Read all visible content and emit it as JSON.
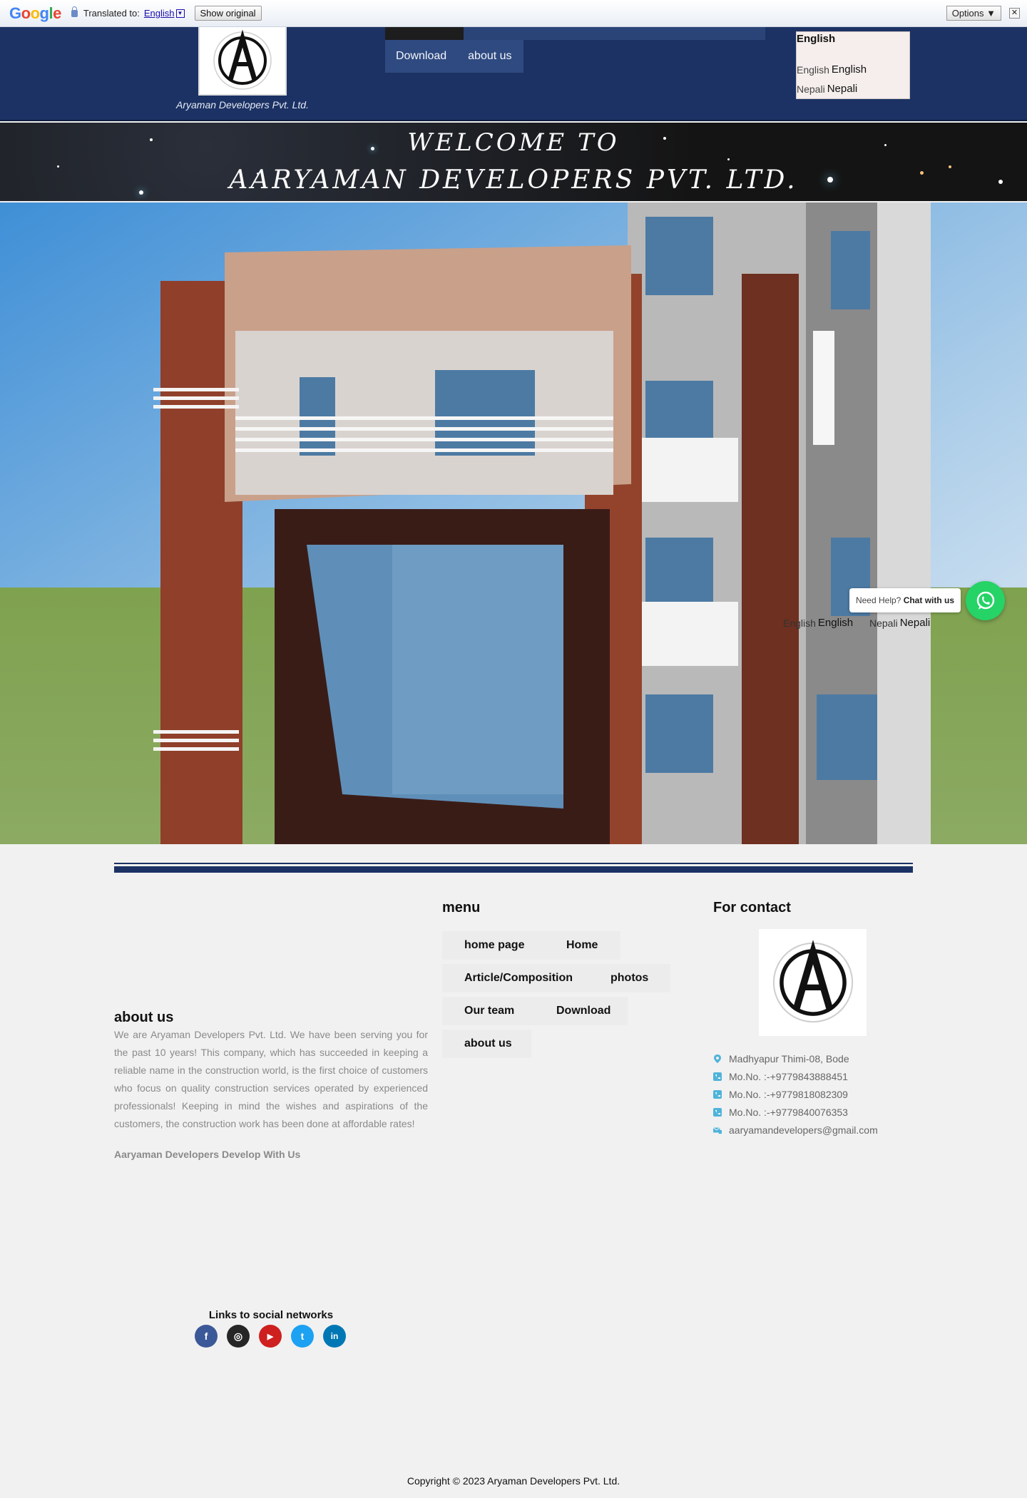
{
  "translate_bar": {
    "logo": "Google",
    "label": "Translated to:",
    "language": "English",
    "show_original": "Show original",
    "options": "Options ▼",
    "close": "✕"
  },
  "header": {
    "company_caption": "Aryaman Developers Pvt. Ltd.",
    "nav": [
      {
        "label": "Download"
      },
      {
        "label": "about us"
      }
    ],
    "language_switcher": {
      "current": "English",
      "options": [
        {
          "alt": "English",
          "label": "English"
        },
        {
          "alt": "Nepali",
          "label": "Nepali"
        }
      ]
    }
  },
  "banner": {
    "line1": "WELCOME TO",
    "line2": "AARYAMAN DEVELOPERS PVT. LTD."
  },
  "hero": {
    "chat_tip_prefix": "Need Help?",
    "chat_tip_strong": "Chat with us",
    "languages": [
      {
        "alt": "English",
        "label": "English"
      },
      {
        "alt": "Nepali",
        "label": "Nepali"
      }
    ]
  },
  "about": {
    "title": "about us",
    "text": "We are Aryaman Developers Pvt. Ltd. We have been serving you for the past 10 years! This company, which has succeeded in keeping a reliable name in the construction world, is the first choice of customers who focus on quality construction services operated by experienced professionals! Keeping in mind the wishes and aspirations of the customers, the construction work has been done at affordable rates!",
    "tagline": "Aaryaman Developers Develop With Us"
  },
  "menu": {
    "title": "menu",
    "items": [
      {
        "label": "home page"
      },
      {
        "label": "Home"
      },
      {
        "label": "Article/Composition"
      },
      {
        "label": "photos"
      },
      {
        "label": "Our team"
      },
      {
        "label": "Download"
      },
      {
        "label": "about us"
      }
    ]
  },
  "contact": {
    "title": "For contact",
    "address": "Madhyapur Thimi-08, Bode",
    "phones": [
      "Mo.No. :-+9779843888451",
      "Mo.No. :-+9779818082309",
      "Mo.No. :-+9779840076353"
    ],
    "email": "aaryamandevelopers@gmail.com"
  },
  "social": {
    "title": "Links to social networks",
    "links": [
      {
        "icon": "facebook-icon",
        "glyph": "f",
        "color": "#3b5998"
      },
      {
        "icon": "instagram-icon",
        "glyph": "◎",
        "color": "#262626"
      },
      {
        "icon": "youtube-icon",
        "glyph": "▶",
        "color": "#cd201f"
      },
      {
        "icon": "twitter-icon",
        "glyph": "t",
        "color": "#1da1f2"
      },
      {
        "icon": "linkedin-icon",
        "glyph": "in",
        "color": "#0077b5"
      }
    ]
  },
  "footer": {
    "copyright": "Copyright © 2023 Aryaman Developers Pvt. Ltd."
  },
  "colors": {
    "header_bg": "#1c3264",
    "whatsapp": "#25d366",
    "contact_icon": "#4fb3d9"
  }
}
